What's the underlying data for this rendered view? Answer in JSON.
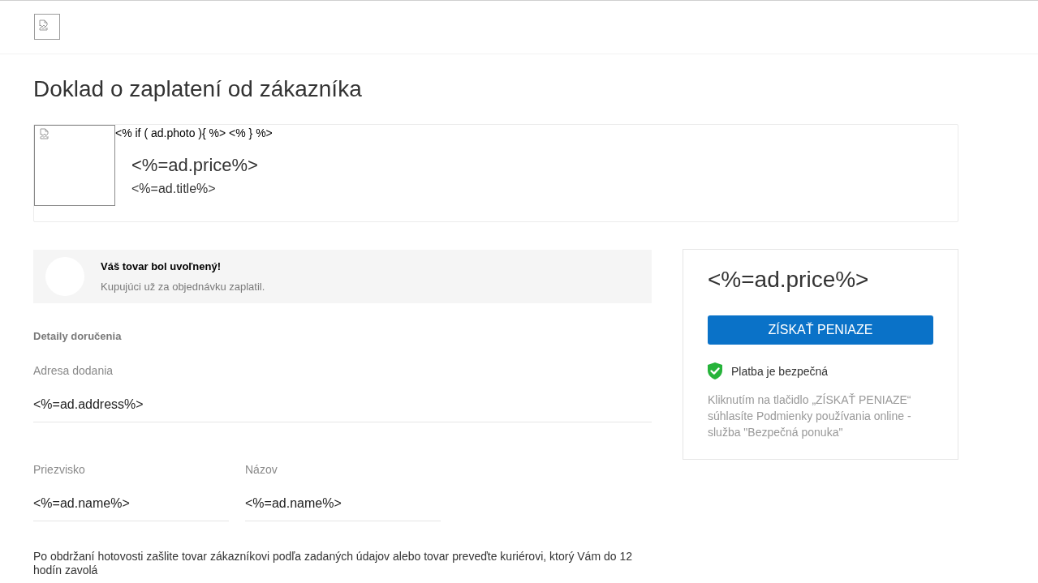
{
  "page": {
    "title": "Doklad o zaplatení od zákazníka"
  },
  "product": {
    "template_line": "<% if ( ad.photo ){ %> <% } %>",
    "price": "<%=ad.price%>",
    "title": "<%=ad.title%>"
  },
  "notice": {
    "title": "Váš tovar bol uvoľnený!",
    "message": "Kupujúci už za objednávku zaplatil."
  },
  "delivery": {
    "heading": "Detaily doručenia",
    "address": {
      "label": "Adresa dodania",
      "value": "<%=ad.address%>"
    },
    "name_fields": [
      {
        "label": "Priezvisko",
        "value": "<%=ad.name%>"
      },
      {
        "label": "Názov",
        "value": "<%=ad.name%>"
      }
    ],
    "instructions": "Po obdržaní hotovosti zašlite tovar zákazníkovi podľa zadaných údajov alebo tovar preveďte kuriérovi, ktorý Vám do 12 hodín zavolá"
  },
  "payment": {
    "price": "<%=ad.price%>",
    "button": "ZÍSKAŤ PENIAZE",
    "secure_note": "Platba je bezpečná",
    "terms": "Kliknutím na tlačidlo „ZÍSKAŤ PENIAZE“ súhlasíte Podmienky používania online - služba \"Bezpečná ponuka\""
  }
}
